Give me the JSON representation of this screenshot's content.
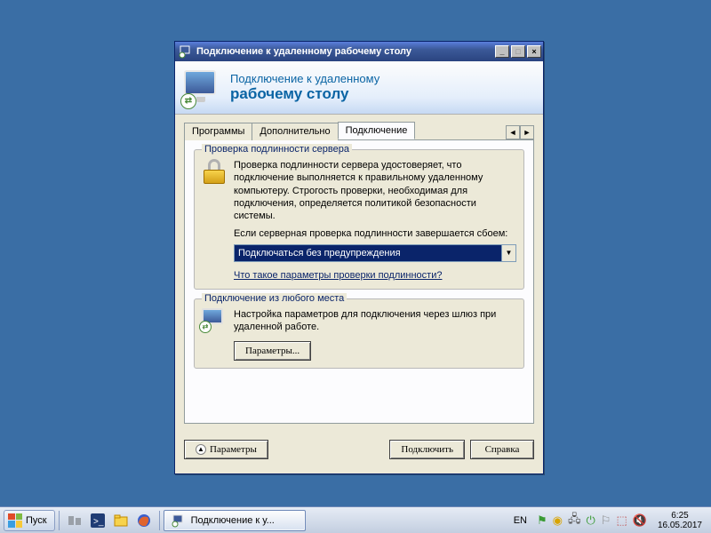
{
  "window": {
    "title": "Подключение к удаленному рабочему столу",
    "banner_line1": "Подключение к удаленному",
    "banner_line2": "рабочему столу"
  },
  "tabs": {
    "programs": "Программы",
    "advanced": "Дополнительно",
    "connection": "Подключение"
  },
  "group_auth": {
    "legend": "Проверка подлинности сервера",
    "desc": "Проверка подлинности сервера удостоверяет, что подключение выполняется к правильному удаленному компьютеру. Строгость проверки, необходимая для подключения, определяется политикой безопасности системы.",
    "fail_label": "Если серверная проверка подлинности завершается сбоем:",
    "combo_value": "Подключаться без предупреждения",
    "link": "Что такое параметры проверки подлинности?"
  },
  "group_anywhere": {
    "legend": "Подключение из любого места",
    "desc": "Настройка параметров для подключения через шлюз при удаленной работе.",
    "params_btn": "Параметры..."
  },
  "dialog_buttons": {
    "options": "Параметры",
    "connect": "Подключить",
    "help": "Справка"
  },
  "taskbar": {
    "start": "Пуск",
    "task_title": "Подключение к у...",
    "lang": "EN",
    "time": "6:25",
    "date": "16.05.2017"
  }
}
